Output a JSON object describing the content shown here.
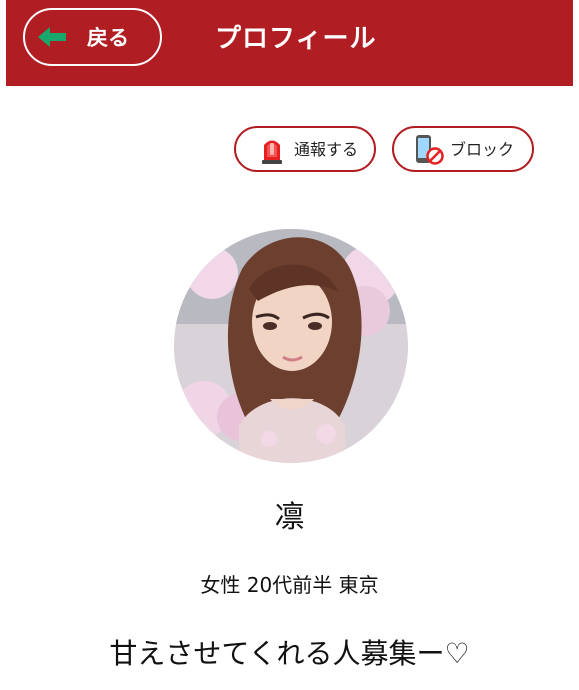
{
  "header": {
    "back_label": "戻る",
    "title": "プロフィール",
    "background_color": "#b01d22"
  },
  "actions": {
    "report_label": "通報する",
    "report_icon": "siren-icon",
    "block_label": "ブロック",
    "block_icon": "phone-block-icon",
    "accent_color": "#b01d22"
  },
  "profile": {
    "avatar": "profile-photo",
    "name": "凛",
    "meta": "女性 20代前半 東京",
    "message": "甘えさせてくれる人募集ー♡"
  }
}
